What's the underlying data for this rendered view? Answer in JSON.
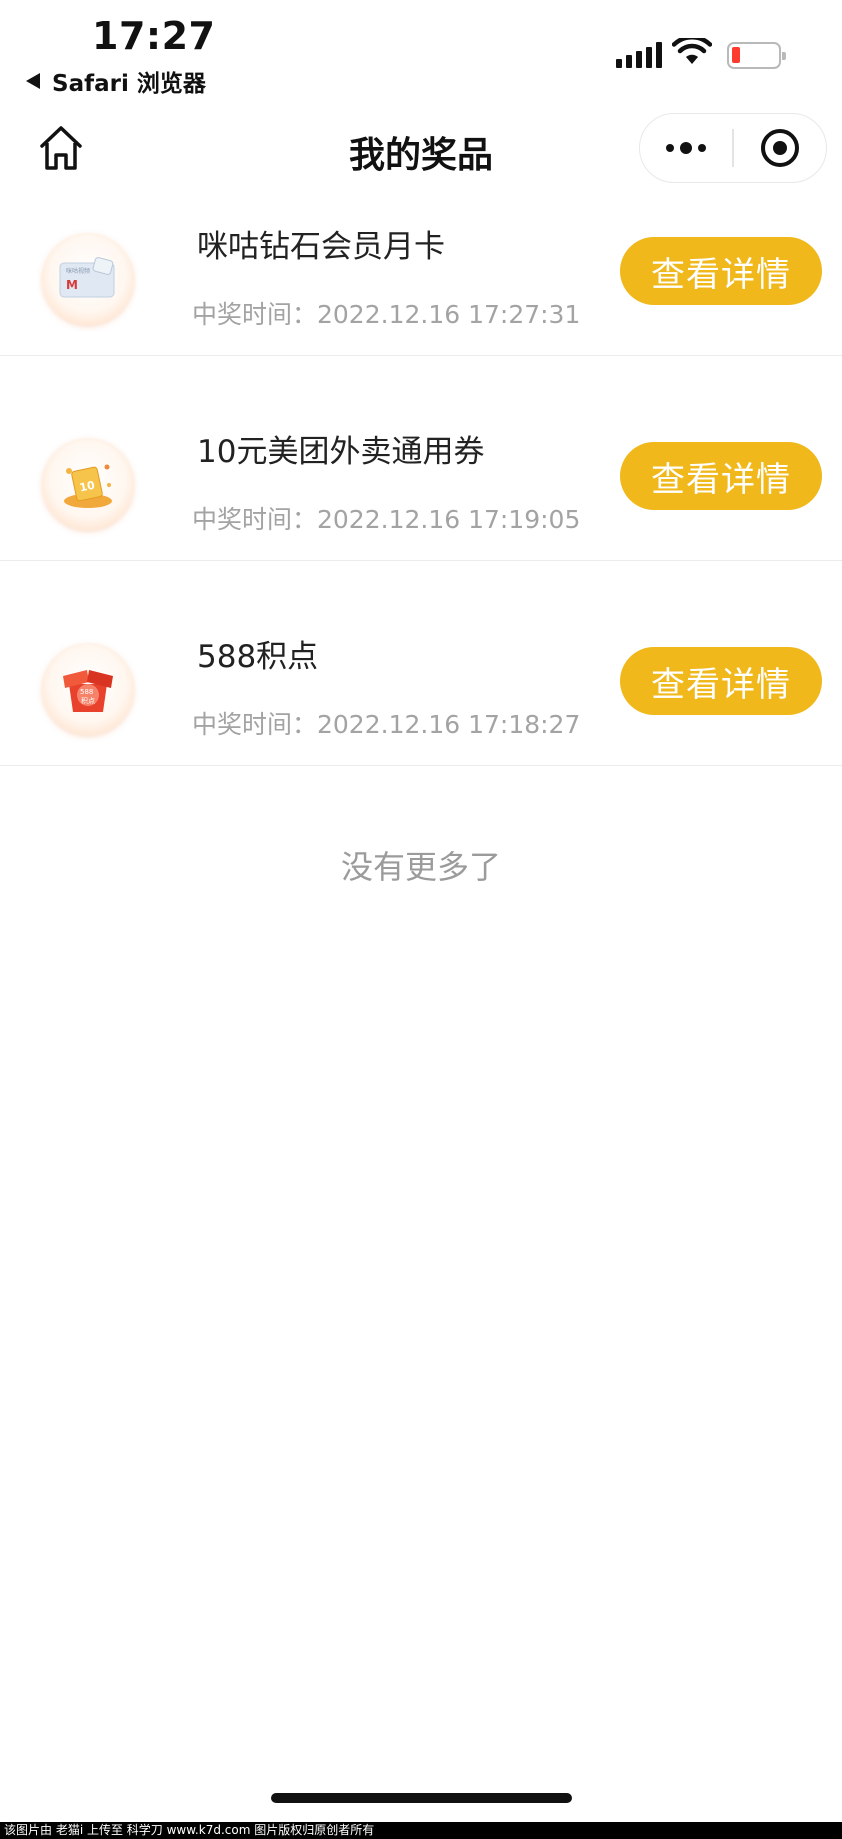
{
  "status_bar": {
    "time": "17:27",
    "back_label": "Safari 浏览器"
  },
  "nav": {
    "title": "我的奖品"
  },
  "prizes": [
    {
      "name": "咪咕钻石会员月卡",
      "time": "中奖时间：2022.12.16 17:27:31",
      "button": "查看详情",
      "icon": "membership-card-icon"
    },
    {
      "name": "10元美团外卖通用券",
      "time": "中奖时间：2022.12.16 17:19:05",
      "button": "查看详情",
      "icon": "coupon-icon"
    },
    {
      "name": "588积点",
      "time": "中奖时间：2022.12.16 17:18:27",
      "button": "查看详情",
      "icon": "gift-box-icon"
    }
  ],
  "prize_icon_texts": {
    "card_brand": "M",
    "card_caption": "咪咕视频",
    "coupon_value": "10",
    "gift_points": "588",
    "gift_unit": "积点"
  },
  "footer": {
    "no_more": "没有更多了"
  },
  "watermark": "该图片由 老猫i 上传至 科学刀 www.k7d.com 图片版权归原创者所有",
  "colors": {
    "accent": "#f0b81b",
    "battery_low": "#ff3b30",
    "secondary_text": "#a3a3a3"
  }
}
